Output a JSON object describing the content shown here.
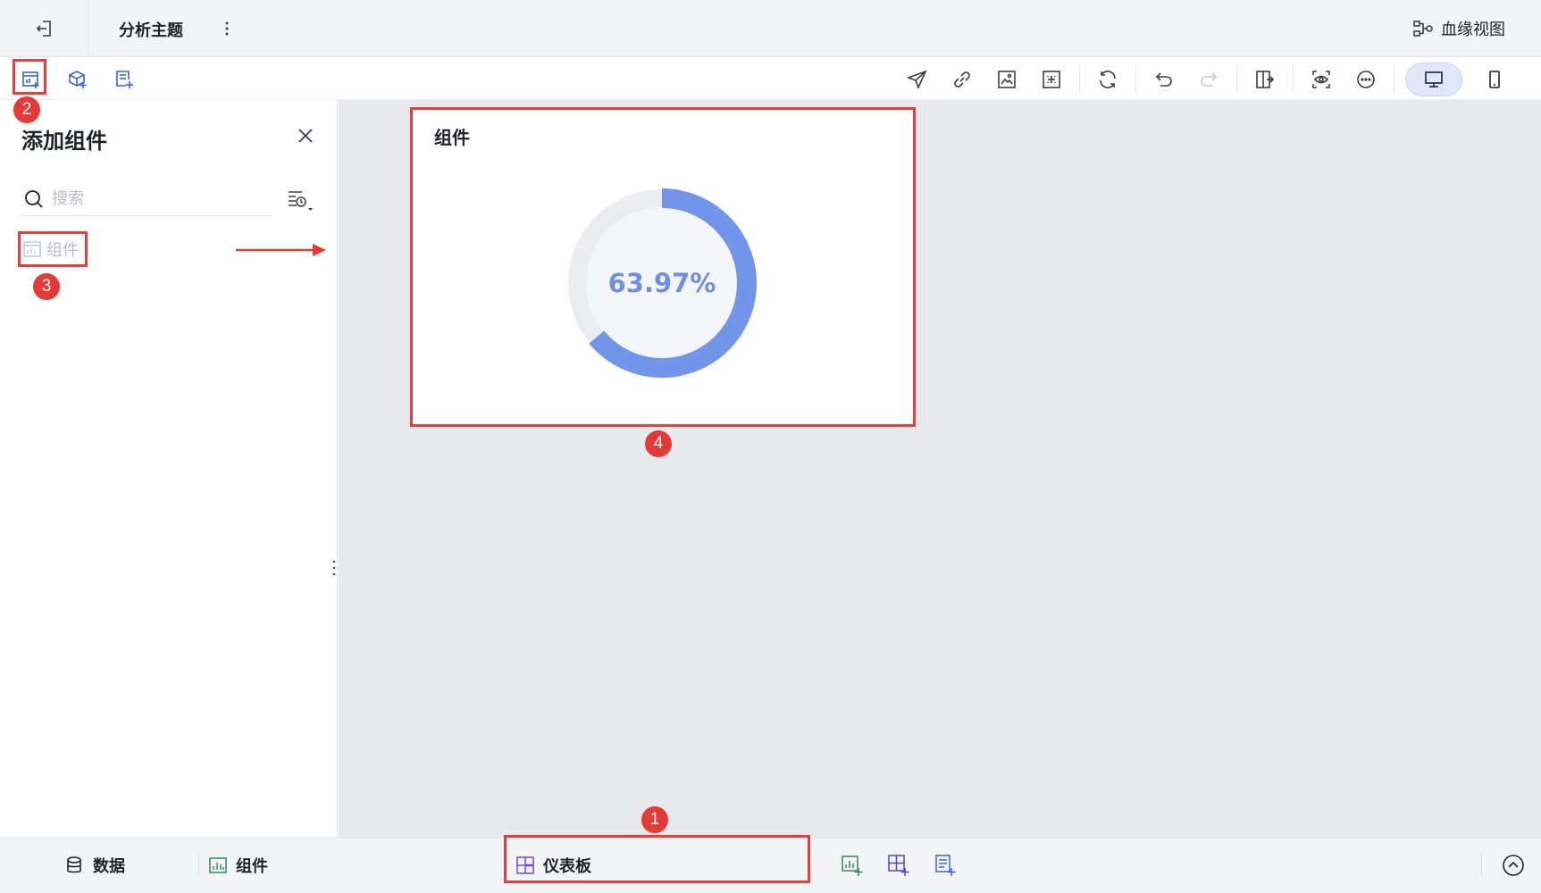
{
  "header": {
    "title": "分析主题",
    "lineage_label": "血缘视图",
    "icons": {
      "back": "exit-icon",
      "more": "more-vertical-icon",
      "lineage": "lineage-icon"
    }
  },
  "toolbar": {
    "left_icons": [
      "add-component-icon",
      "add-model-icon",
      "add-report-icon"
    ],
    "right_icons": [
      "send-icon",
      "link-icon",
      "image-export-icon",
      "fit-screen-icon",
      "refresh-icon",
      "undo-icon",
      "redo-icon",
      "switch-layout-icon",
      "preview-icon",
      "more-horizontal-icon",
      "desktop-icon",
      "mobile-icon"
    ]
  },
  "panel": {
    "title": "添加组件",
    "search_placeholder": "搜索",
    "items": [
      {
        "label": "组件",
        "icon": "chart-component-icon"
      }
    ]
  },
  "widget": {
    "title": "组件",
    "value_label": "63.97%",
    "progress": 0.6397,
    "colors": {
      "progress": "#7195e8",
      "track": "#ebecf0",
      "inner": "#f4f5f8",
      "text": "#6f8fe4"
    }
  },
  "bottom_tabs": {
    "data_label": "数据",
    "component_label": "组件",
    "dashboard_label": "仪表板",
    "action_icons": [
      "add-component-tab-icon",
      "add-dashboard-tab-icon",
      "add-report-tab-icon"
    ],
    "expand_icon": "chevron-up-circle-icon"
  },
  "annotations": {
    "badge1": "1",
    "badge2": "2",
    "badge3": "3",
    "badge4": "4"
  },
  "accent_color": "#e53935"
}
